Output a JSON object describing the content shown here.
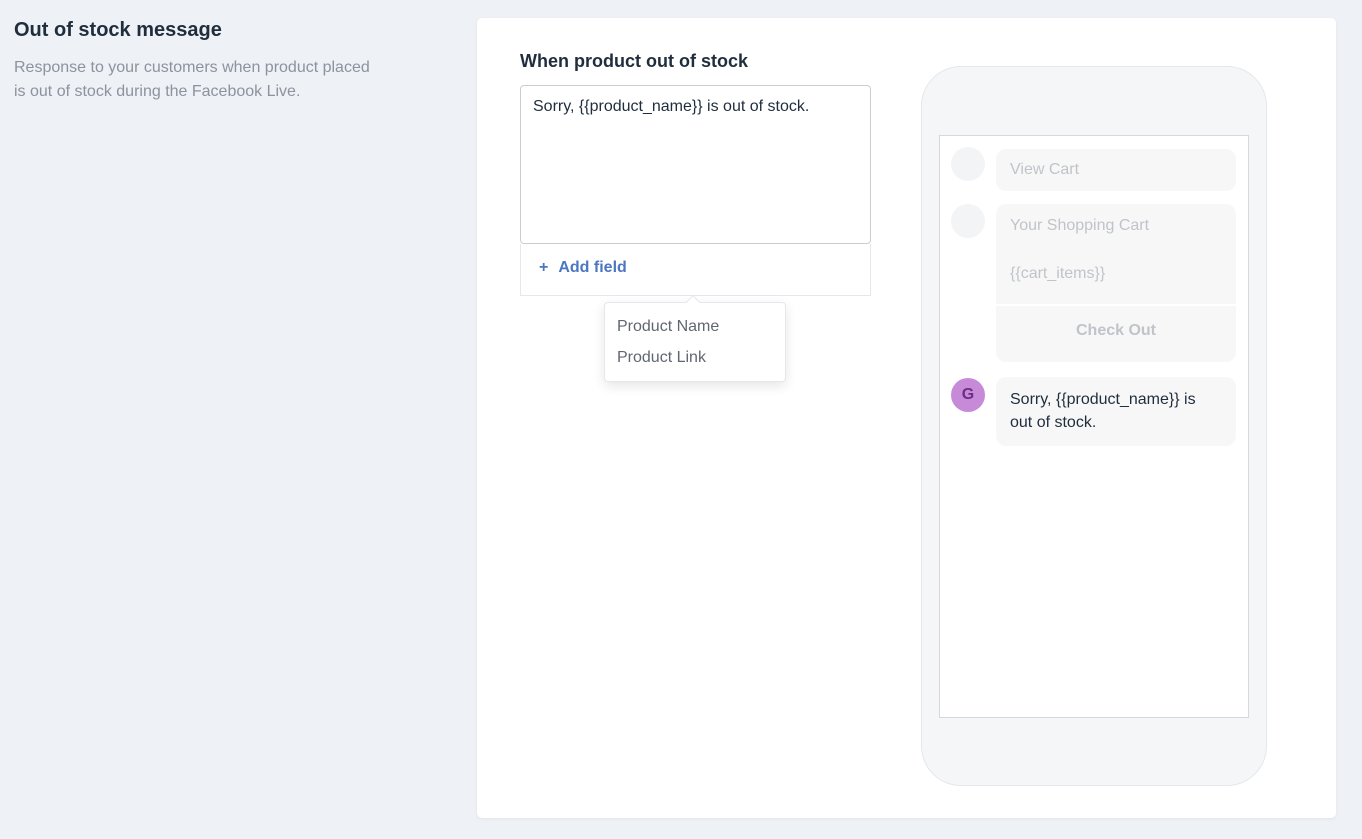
{
  "sidebar": {
    "title": "Out of stock message",
    "description": "Response to your customers when product placed is out of stock during the Facebook Live."
  },
  "form": {
    "label": "When product out of stock",
    "message": "Sorry, {{product_name}} is out of stock.",
    "add_field": {
      "icon": "+",
      "label": "Add field"
    },
    "dropdown_options": [
      "Product Name",
      "Product Link"
    ]
  },
  "preview": {
    "view_cart": "View Cart",
    "cart_title": "Your Shopping Cart",
    "cart_items": "{{cart_items}}",
    "checkout": "Check Out",
    "bot_avatar_letter": "G",
    "bot_message": "Sorry, {{product_name}} is out of stock."
  },
  "colors": {
    "accent": "#4a76c2",
    "avatar": "#c68ad8",
    "background": "#eef1f5"
  }
}
